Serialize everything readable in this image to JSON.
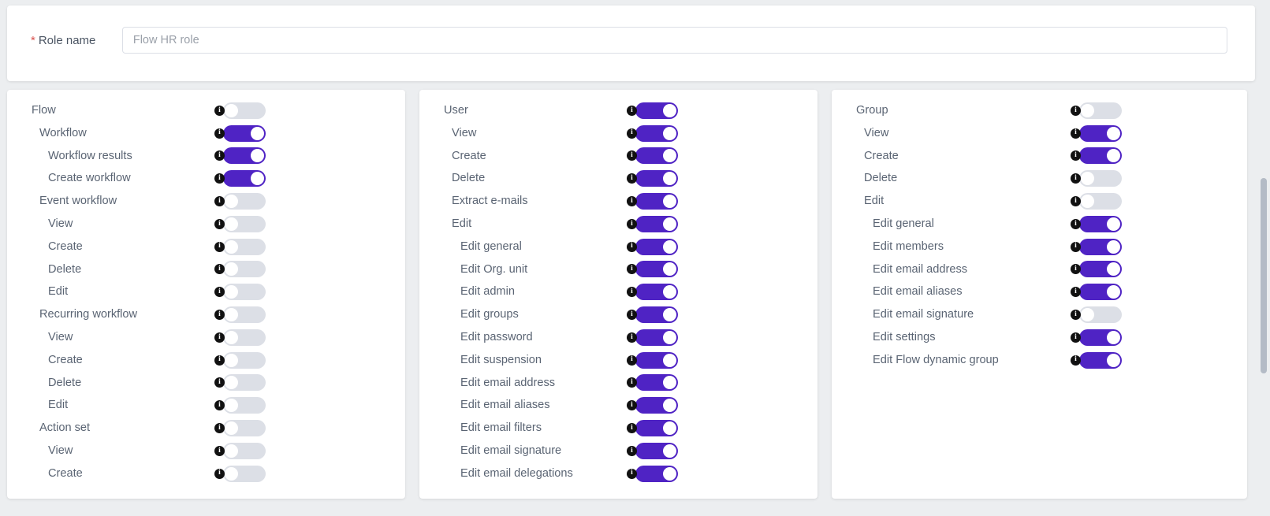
{
  "form": {
    "required_marker": "*",
    "role_name_label": "Role name",
    "role_name_value": "Flow HR role",
    "role_name_placeholder": "Role name"
  },
  "colors": {
    "toggle_on": "#4f23c4",
    "toggle_off": "#dcdfe6",
    "required_star": "#d9534f",
    "label_text": "#5a6473",
    "page_background": "#eceef0"
  },
  "icons": {
    "info": "info-icon"
  },
  "columns": [
    {
      "id": "flow",
      "title": "Flow",
      "rows": [
        {
          "label": "Flow",
          "level": 0,
          "on": false
        },
        {
          "label": "Workflow",
          "level": 1,
          "on": true
        },
        {
          "label": "Workflow results",
          "level": 2,
          "on": true
        },
        {
          "label": "Create workflow",
          "level": 2,
          "on": true
        },
        {
          "label": "Event workflow",
          "level": 1,
          "on": false
        },
        {
          "label": "View",
          "level": 2,
          "on": false
        },
        {
          "label": "Create",
          "level": 2,
          "on": false
        },
        {
          "label": "Delete",
          "level": 2,
          "on": false
        },
        {
          "label": "Edit",
          "level": 2,
          "on": false
        },
        {
          "label": "Recurring workflow",
          "level": 1,
          "on": false
        },
        {
          "label": "View",
          "level": 2,
          "on": false
        },
        {
          "label": "Create",
          "level": 2,
          "on": false
        },
        {
          "label": "Delete",
          "level": 2,
          "on": false
        },
        {
          "label": "Edit",
          "level": 2,
          "on": false
        },
        {
          "label": "Action set",
          "level": 1,
          "on": false
        },
        {
          "label": "View",
          "level": 2,
          "on": false
        },
        {
          "label": "Create",
          "level": 2,
          "on": false
        }
      ]
    },
    {
      "id": "user",
      "title": "User",
      "rows": [
        {
          "label": "User",
          "level": 0,
          "on": true
        },
        {
          "label": "View",
          "level": 1,
          "on": true
        },
        {
          "label": "Create",
          "level": 1,
          "on": true
        },
        {
          "label": "Delete",
          "level": 1,
          "on": true
        },
        {
          "label": "Extract e-mails",
          "level": 1,
          "on": true
        },
        {
          "label": "Edit",
          "level": 1,
          "on": true
        },
        {
          "label": "Edit general",
          "level": 2,
          "on": true
        },
        {
          "label": "Edit Org. unit",
          "level": 2,
          "on": true
        },
        {
          "label": "Edit admin",
          "level": 2,
          "on": true
        },
        {
          "label": "Edit groups",
          "level": 2,
          "on": true
        },
        {
          "label": "Edit password",
          "level": 2,
          "on": true
        },
        {
          "label": "Edit suspension",
          "level": 2,
          "on": true
        },
        {
          "label": "Edit email address",
          "level": 2,
          "on": true
        },
        {
          "label": "Edit email aliases",
          "level": 2,
          "on": true
        },
        {
          "label": "Edit email filters",
          "level": 2,
          "on": true
        },
        {
          "label": "Edit email signature",
          "level": 2,
          "on": true
        },
        {
          "label": "Edit email delegations",
          "level": 2,
          "on": true
        }
      ]
    },
    {
      "id": "group",
      "title": "Group",
      "rows": [
        {
          "label": "Group",
          "level": 0,
          "on": false
        },
        {
          "label": "View",
          "level": 1,
          "on": true
        },
        {
          "label": "Create",
          "level": 1,
          "on": true
        },
        {
          "label": "Delete",
          "level": 1,
          "on": false
        },
        {
          "label": "Edit",
          "level": 1,
          "on": false
        },
        {
          "label": "Edit general",
          "level": 2,
          "on": true
        },
        {
          "label": "Edit members",
          "level": 2,
          "on": true
        },
        {
          "label": "Edit email address",
          "level": 2,
          "on": true
        },
        {
          "label": "Edit email aliases",
          "level": 2,
          "on": true
        },
        {
          "label": "Edit email signature",
          "level": 2,
          "on": false
        },
        {
          "label": "Edit settings",
          "level": 2,
          "on": true
        },
        {
          "label": "Edit Flow dynamic group",
          "level": 2,
          "on": true
        }
      ]
    }
  ]
}
